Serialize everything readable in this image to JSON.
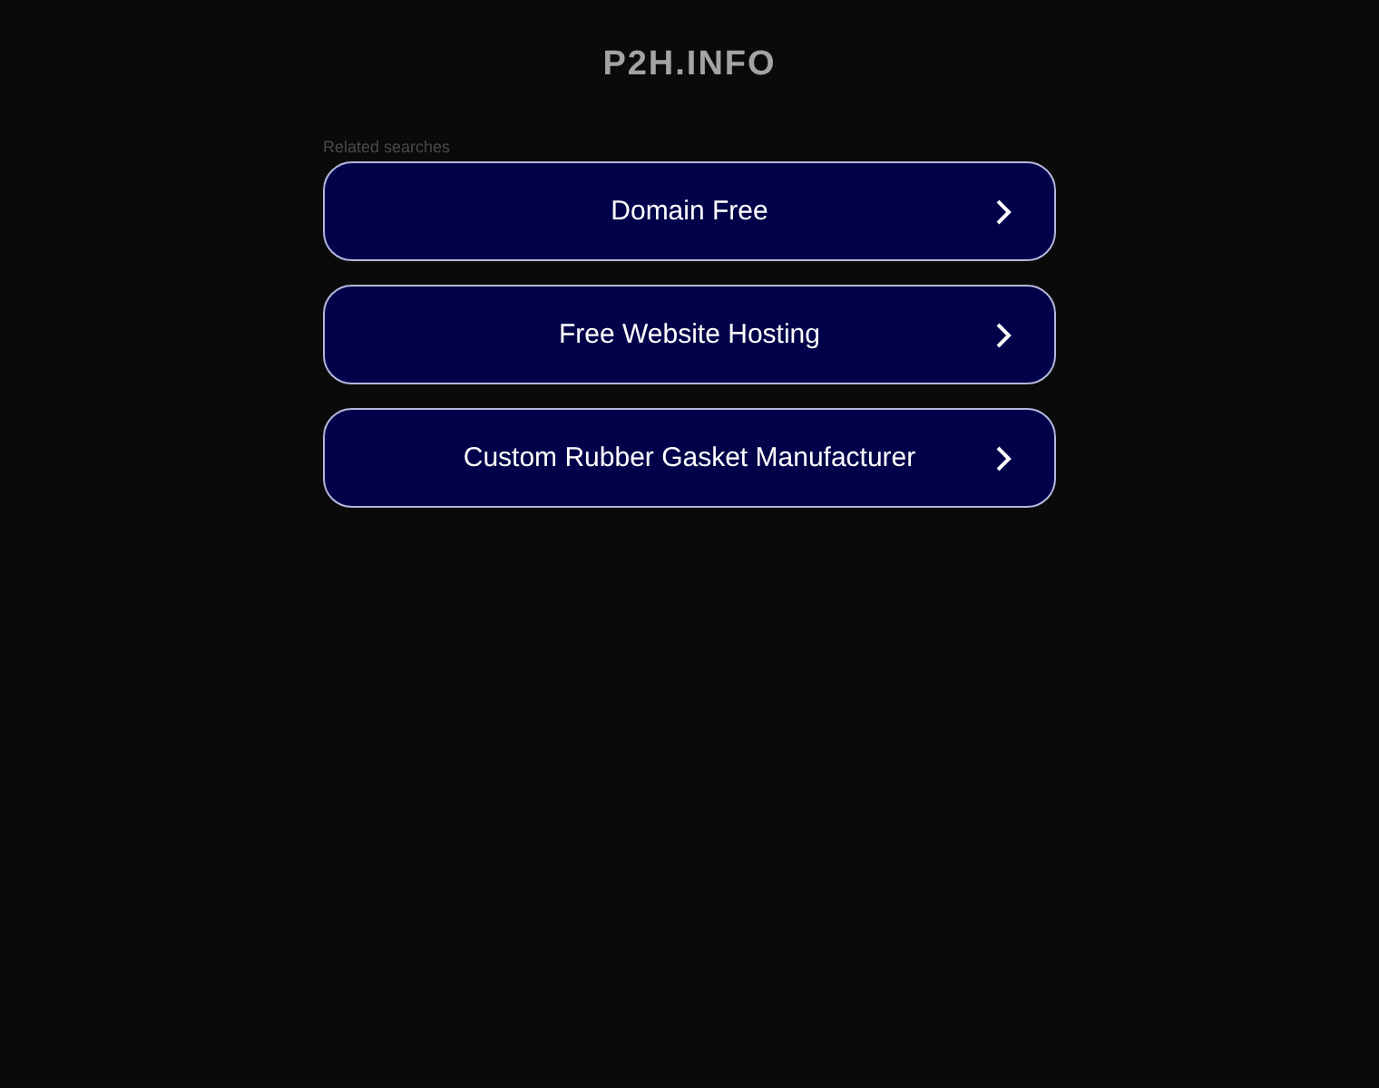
{
  "site_title": "P2H.INFO",
  "related": {
    "heading": "Related searches",
    "links": [
      {
        "label": "Domain Free"
      },
      {
        "label": "Free Website Hosting"
      },
      {
        "label": "Custom Rubber Gasket Manufacturer"
      }
    ]
  }
}
